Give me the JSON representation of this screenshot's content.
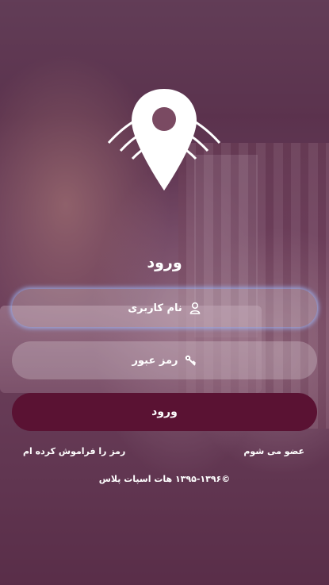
{
  "login": {
    "title": "ورود",
    "username_placeholder": "نام کاربری",
    "password_placeholder": "رمز عبور",
    "submit_label": "ورود",
    "join_label": "عضو می شوم",
    "forgot_label": "رمز را فراموش کرده ام",
    "copyright": "©۱۳۹۵-۱۳۹۶ هات اسپات پلاس"
  },
  "icons": {
    "logo": "location-pin-wifi-logo",
    "username": "user-icon",
    "password": "key-icon"
  },
  "colors": {
    "overlay": "#581e42",
    "button": "#5a1233",
    "text": "#ffffff"
  }
}
